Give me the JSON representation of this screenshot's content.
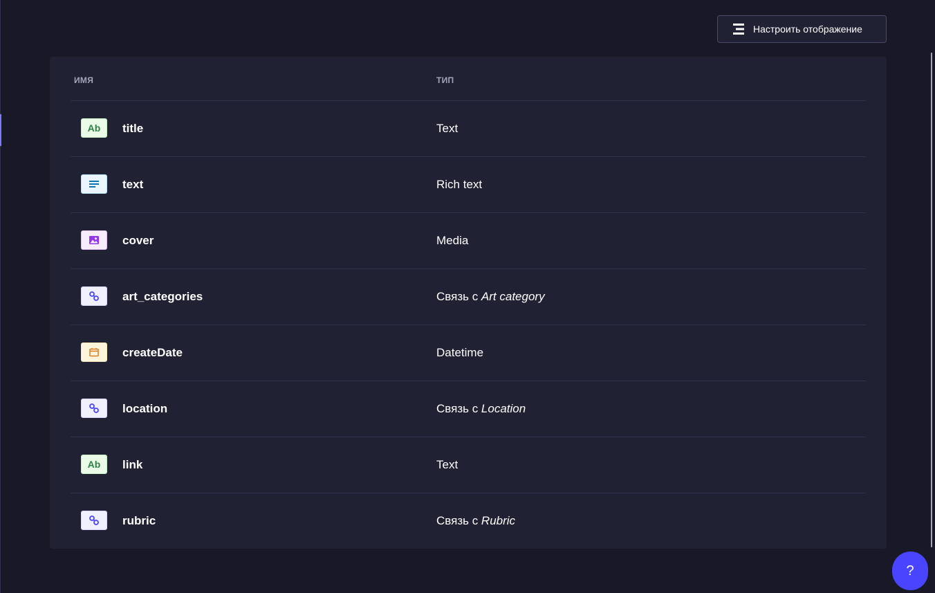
{
  "toolbar": {
    "configure_view_label": "Настроить отображение",
    "configure_view_icon": "layout-icon"
  },
  "table": {
    "columns": {
      "name": "ИМЯ",
      "type": "ТИП"
    },
    "rows": [
      {
        "name": "title",
        "type_prefix": "Text",
        "type_target": "",
        "icon": "text-field-icon",
        "icon_text": "Ab"
      },
      {
        "name": "text",
        "type_prefix": "Rich text",
        "type_target": "",
        "icon": "rich-text-icon",
        "icon_text": ""
      },
      {
        "name": "cover",
        "type_prefix": "Media",
        "type_target": "",
        "icon": "media-icon",
        "icon_text": ""
      },
      {
        "name": "art_categories",
        "type_prefix": "Связь с ",
        "type_target": "Art category",
        "icon": "relation-icon",
        "icon_text": ""
      },
      {
        "name": "createDate",
        "type_prefix": "Datetime",
        "type_target": "",
        "icon": "calendar-icon",
        "icon_text": ""
      },
      {
        "name": "location",
        "type_prefix": "Связь с ",
        "type_target": "Location",
        "icon": "relation-icon",
        "icon_text": ""
      },
      {
        "name": "link",
        "type_prefix": "Text",
        "type_target": "",
        "icon": "text-field-icon",
        "icon_text": "Ab"
      },
      {
        "name": "rubric",
        "type_prefix": "Связь с ",
        "type_target": "Rubric",
        "icon": "relation-icon",
        "icon_text": ""
      }
    ]
  },
  "help": {
    "label": "?",
    "icon": "help-icon"
  },
  "colors": {
    "background": "#181826",
    "card": "#212134",
    "accent": "#4945ff",
    "text_badge": "#328048",
    "relation_badge": "#4945ff",
    "media_badge": "#9736e8",
    "date_badge": "#d9822f",
    "rich_text_badge": "#0c75af"
  }
}
